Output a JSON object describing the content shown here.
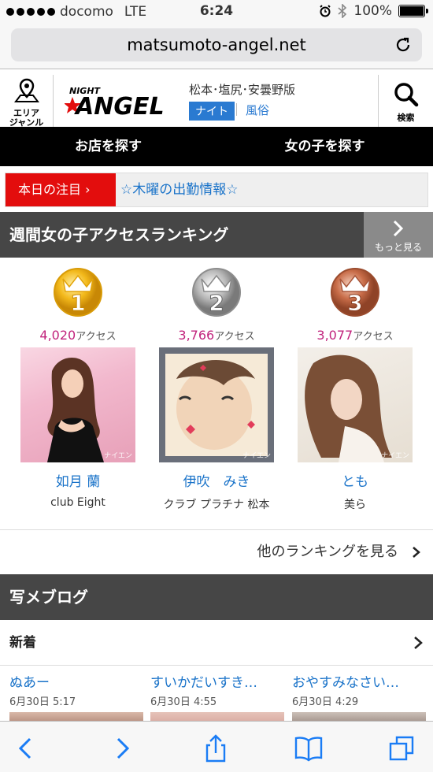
{
  "status": {
    "carrier": "docomo",
    "network": "LTE",
    "time": "6:24",
    "battery": "100%"
  },
  "url": "matsumoto-angel.net",
  "header": {
    "area_label_line1": "エリア",
    "area_label_line2": "ジャンル",
    "logo_small": "NIGHT",
    "logo_big": "ANGEL",
    "region": "松本･塩尻･安曇野版",
    "tag_night": "ナイト",
    "tag_fuzoku": "風俗",
    "search_label": "検索"
  },
  "nav": {
    "find_shop": "お店を探す",
    "find_girl": "女の子を探す"
  },
  "notice": {
    "badge": "本日の注目 ›",
    "message": "☆木曜の出勤情報☆"
  },
  "ranking": {
    "title": "週間女の子アクセスランキング",
    "more": "もっと見る",
    "access_suffix": "アクセス",
    "items": [
      {
        "rank": "1",
        "access": "4,020",
        "name": "如月 蘭",
        "shop": "club Eight",
        "watermark": "ナイエン"
      },
      {
        "rank": "2",
        "access": "3,766",
        "name": "伊吹　みき",
        "shop": "クラブ プラチナ 松本",
        "watermark": "ナイエン"
      },
      {
        "rank": "3",
        "access": "3,077",
        "name": "とも",
        "shop": "美ら",
        "watermark": "ナイエン"
      }
    ],
    "others_link": "他のランキングを見る"
  },
  "blog": {
    "title": "写メブログ",
    "new_label": "新着",
    "items": [
      {
        "title": "ぬあー",
        "date": "6月30日 5:17"
      },
      {
        "title": "すいかだいすき…",
        "date": "6月30日 4:55"
      },
      {
        "title": "おやすみなさい…",
        "date": "6月30日 4:29"
      }
    ]
  },
  "colors": {
    "accent_blue": "#1a73c9",
    "notice_red": "#e30d0d",
    "access_pink": "#c1237c",
    "section_gray": "#464646"
  }
}
